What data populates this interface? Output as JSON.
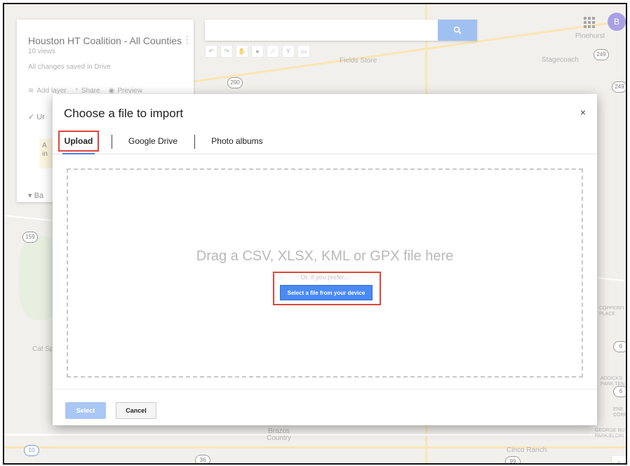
{
  "map": {
    "labels": {
      "pinehurst": "Pinehurst",
      "stagecoach": "Stagecoach",
      "fields_store": "Fields Store",
      "cat_spring": "Cat Sp",
      "copperfield": "COPPERFI\nPLACE",
      "brazos_country": "Brazos\nCountry",
      "cinco_ranch": "Cinco Ranch",
      "addicks": "ADDICKS\nPARK TEN",
      "george_bush": "GEORGE BU\nPARK/ELDRI",
      "energy": "ENE\nCORR"
    },
    "shields": {
      "s249a": "249",
      "s249b": "249",
      "s290": "290",
      "s159": "159",
      "s6a": "6",
      "s6b": "6",
      "s36": "36",
      "s99": "99",
      "s10": "10"
    }
  },
  "left_panel": {
    "title": "Houston HT Coalition - All Counties",
    "views": "10 views",
    "saved": "All changes saved in Drive",
    "actions": [
      "Add layer",
      "Share",
      "Preview"
    ],
    "row1": "Ur",
    "row2": "A\nin",
    "row3": "Ba"
  },
  "user": {
    "avatar_letter": "B"
  },
  "dialog": {
    "title": "Choose a file to import",
    "close": "×",
    "tabs": [
      "Upload",
      "Google Drive",
      "Photo albums"
    ],
    "drop_text": "Drag a CSV, XLSX, KML or GPX file here",
    "or_text": "Or, if you prefer...",
    "select_device_label": "Select a file from your device",
    "select_label": "Select",
    "cancel_label": "Cancel"
  },
  "colors": {
    "accent": "#4a8af4",
    "highlight": "#e0453a"
  }
}
